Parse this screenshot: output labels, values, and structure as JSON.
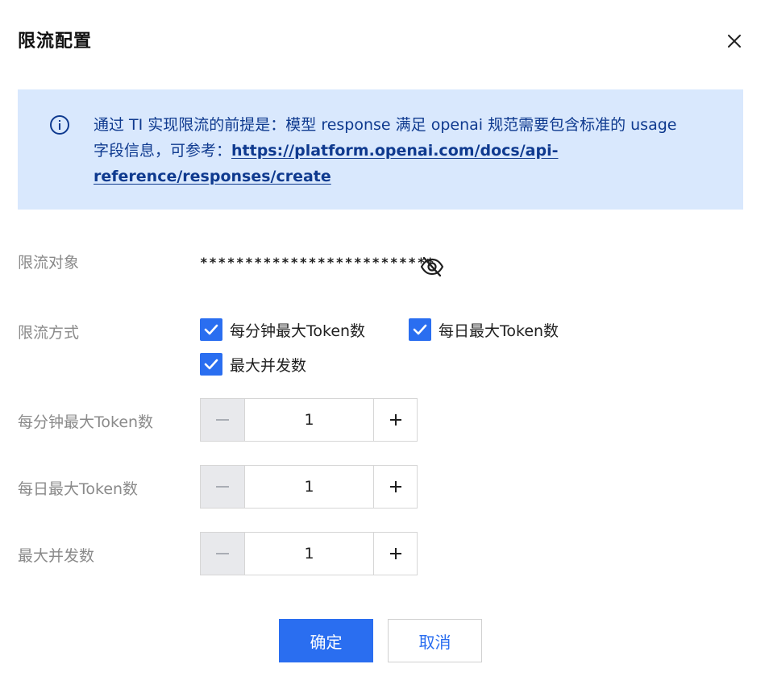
{
  "dialog": {
    "title": "限流配置",
    "close_icon": "close-icon"
  },
  "notice": {
    "icon": "info-icon",
    "text_before_link": "通过 TI 实现限流的前提是：模型 response 满足 openai 规范需要包含标准的 usage 字段信息，可参考：",
    "link": "https://platform.openai.com/docs/api-reference/responses/create"
  },
  "form": {
    "target": {
      "label": "限流对象",
      "masked_value": "**************************",
      "toggle_icon": "eye-off-icon"
    },
    "method": {
      "label": "限流方式",
      "options": [
        {
          "label": "每分钟最大Token数",
          "checked": true
        },
        {
          "label": "每日最大Token数",
          "checked": true
        },
        {
          "label": "最大并发数",
          "checked": true
        }
      ]
    },
    "steppers": [
      {
        "label": "每分钟最大Token数",
        "value": "1"
      },
      {
        "label": "每日最大Token数",
        "value": "1"
      },
      {
        "label": "最大并发数",
        "value": "1"
      }
    ]
  },
  "footer": {
    "ok_label": "确定",
    "cancel_label": "取消"
  },
  "colors": {
    "primary": "#2a6ef0",
    "notice_bg": "#d9e8fd",
    "notice_text": "#0f3a8f",
    "label": "#8a8a8a"
  }
}
